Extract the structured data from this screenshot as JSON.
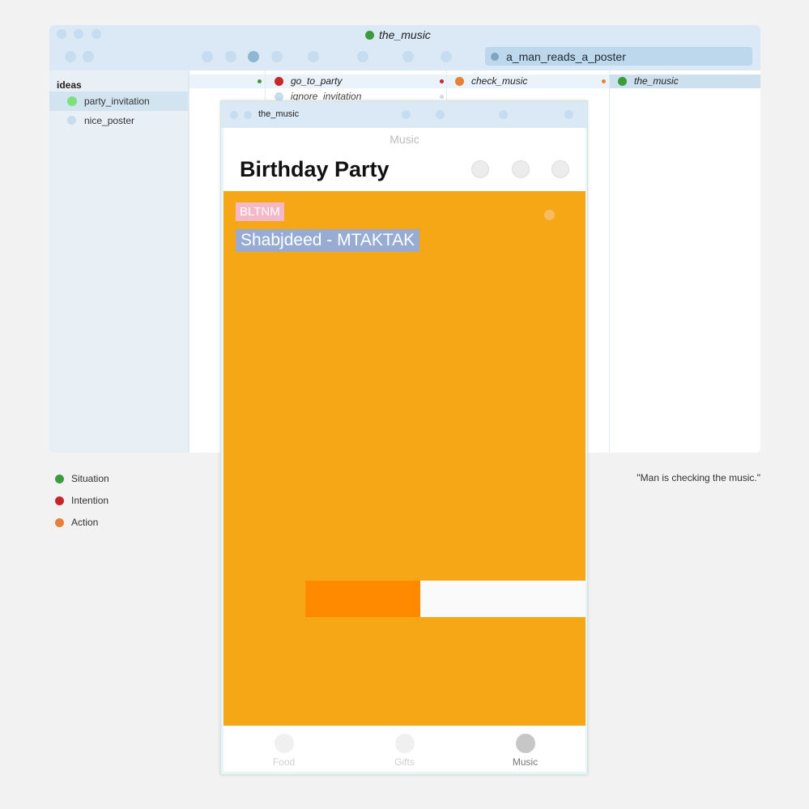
{
  "window": {
    "title": "the_music",
    "search_value": "a_man_reads_a_poster"
  },
  "sidebar": {
    "heading": "ideas",
    "items": [
      {
        "label": "party_invitation",
        "selected": true
      },
      {
        "label": "nice_poster",
        "selected": false
      }
    ]
  },
  "columns": {
    "intentions": [
      "go_to_party",
      "ignore_invitation"
    ],
    "actions": [
      "check_music"
    ],
    "situations": [
      "the_music"
    ]
  },
  "legend": [
    {
      "label": "Situation",
      "color": "#3c9b3c"
    },
    {
      "label": "Intention",
      "color": "#c62828"
    },
    {
      "label": "Action",
      "color": "#e8803a"
    }
  ],
  "caption": "\"Man is checking the music.\"",
  "phone": {
    "window_title": "the_music",
    "screen_label": "Music",
    "heading": "Birthday Party",
    "badge": "BLTNM",
    "song": "Shabjdeed - MTAKTAK",
    "progress": 0.41,
    "tabs": [
      {
        "label": "Food",
        "active": false
      },
      {
        "label": "Gifts",
        "active": false
      },
      {
        "label": "Music",
        "active": true
      }
    ]
  },
  "colors": {
    "situation": "#3c9b3c",
    "intention": "#c62828",
    "action": "#e8803a",
    "panel": "#f5a716",
    "progress_fill": "#ff8a00"
  }
}
